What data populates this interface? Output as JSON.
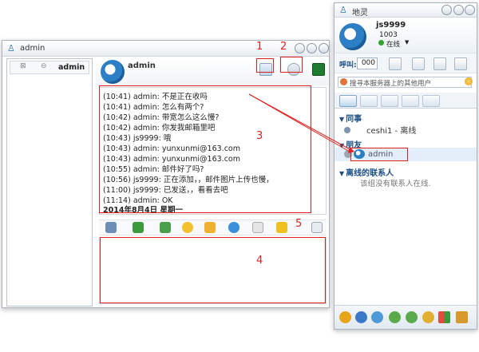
{
  "chat_window": {
    "title": "admin",
    "tab_contact": "admin",
    "header_name": "admin",
    "messages": [
      {
        "time": "(10:41)",
        "sender": "admin:",
        "text": "不是正在收吗"
      },
      {
        "time": "(10:41)",
        "sender": "admin:",
        "text": "怎么有两个?"
      },
      {
        "time": "(10:42)",
        "sender": "admin:",
        "text": "带宽怎么这么慢?"
      },
      {
        "time": "(10:42)",
        "sender": "admin:",
        "text": "你发我邮箱里吧"
      },
      {
        "time": "(10:43)",
        "sender": "js9999:",
        "text": "哦"
      },
      {
        "time": "(10:43)",
        "sender": "admin:",
        "text": "yunxunmi@163.com"
      },
      {
        "time": "(10:43)",
        "sender": "admin:",
        "text": "yunxunmi@163.com"
      },
      {
        "time": "(10:55)",
        "sender": "admin:",
        "text": "邮件好了吗?"
      },
      {
        "time": "(10:56)",
        "sender": "js9999:",
        "text": "正在添加，，邮件图片上传也慢，"
      },
      {
        "time": "(11:00)",
        "sender": "js9999:",
        "text": "已发送，，看看去吧"
      },
      {
        "time": "(11:14)",
        "sender": "admin:",
        "text": "OK"
      }
    ],
    "date_line": "2014年8月4日 星期一",
    "input_value": ""
  },
  "annotations": [
    "1",
    "2",
    "3",
    "4",
    "5"
  ],
  "contact_window": {
    "title": "地灵",
    "user_id": "js9999",
    "user_number": "1003",
    "status": "在线",
    "call_label": "呼叫:",
    "call_number": "000",
    "search_placeholder": "搜寻本服务器上的其他用户",
    "groups": [
      {
        "name": "同事",
        "contacts": [
          {
            "name": "ceshi1",
            "status": "- 离线"
          }
        ]
      },
      {
        "name": "朋友",
        "contacts": [
          {
            "name": "admin",
            "status": ""
          }
        ]
      },
      {
        "name": "离线的联系人",
        "empty_text": "该组没有联系人在线."
      }
    ]
  },
  "colors": {
    "annotation": "#e02020",
    "group_title": "#1c4f84",
    "online": "#2fa52f",
    "brand": "#2c7fc4"
  },
  "icons": {
    "toolbar": [
      "voice-icon",
      "file-transfer-icon",
      "image-icon",
      "emoticon-icon",
      "lock-icon",
      "bubble-icon",
      "mail-icon",
      "nudge-icon",
      "resize-icon"
    ],
    "header": [
      "video-call-icon",
      "voice-call-icon",
      "screen-share-icon"
    ],
    "bottom": [
      "brand-icon",
      "info-icon",
      "settings-icon",
      "add-contact-icon",
      "contacts-icon",
      "group-icon",
      "apps-icon",
      "export-icon"
    ]
  }
}
